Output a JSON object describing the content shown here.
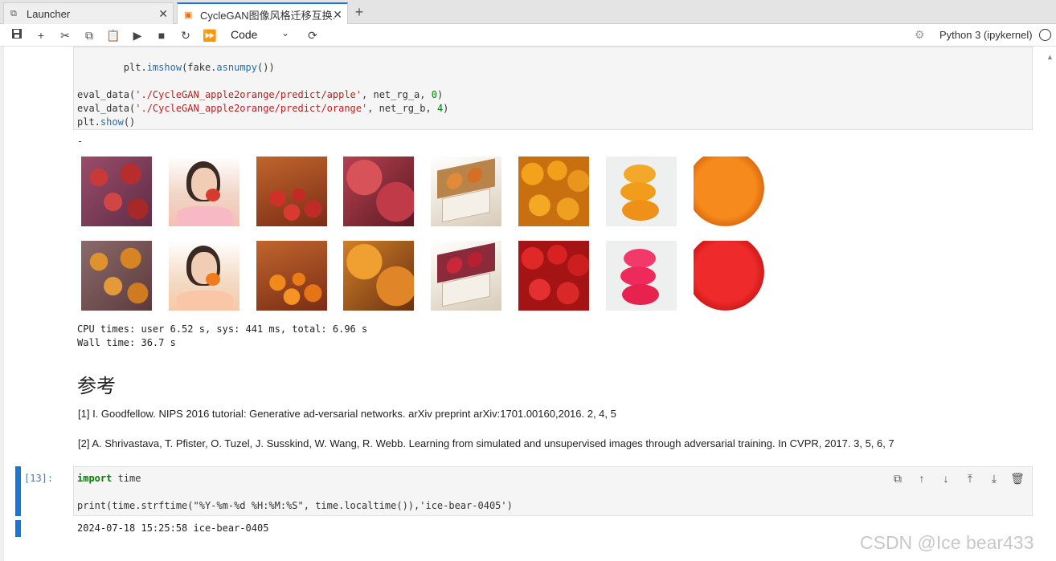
{
  "tabs": [
    {
      "label": "Launcher",
      "icon": "external-link-icon"
    },
    {
      "label": "CycleGAN图像风格迁移互换.",
      "icon": "notebook-icon"
    }
  ],
  "toolbar": {
    "cell_type": "Code",
    "kernel": "Python 3 (ipykernel)"
  },
  "code_cell_top": {
    "lines": [
      "        plt.imshow(fake.asnumpy())",
      "",
      "eval_data('./CycleGAN_apple2orange/predict/apple', net_rg_a, 0)",
      "eval_data('./CycleGAN_apple2orange/predict/orange', net_rg_b, 4)",
      "plt.show()"
    ]
  },
  "output_top": {
    "dash": "-",
    "row1_images": [
      "red-apples-pile",
      "woman-eating-apple",
      "apples-in-basket",
      "apples-closeup",
      "fruit-box",
      "oranges-pile",
      "orange-stack",
      "orange-texture"
    ],
    "row2_images": [
      "oranges-pile-converted",
      "woman-eating-orange",
      "oranges-in-basket",
      "oranges-closeup",
      "fruit-box-red",
      "red-apples-converted",
      "red-stack",
      "red-texture"
    ],
    "cpu_times": "CPU times: user 6.52 s, sys: 441 ms, total: 6.96 s",
    "wall_time": "Wall time: 36.7 s"
  },
  "markdown": {
    "heading": "参考",
    "ref1": "[1] I. Goodfellow. NIPS 2016 tutorial: Generative ad-versarial networks. arXiv preprint arXiv:1701.00160,2016. 2, 4, 5",
    "ref2": "[2] A. Shrivastava, T. Pfister, O. Tuzel, J. Susskind, W. Wang, R. Webb. Learning from simulated and unsupervised images through adversarial training. In CVPR, 2017. 3, 5, 6, 7"
  },
  "code_cell_bottom": {
    "prompt": "[13]:",
    "line1_kw": "import",
    "line1_rest": " time",
    "line2": "print(time.strftime(\"%Y-%m-%d %H:%M:%S\", time.localtime()),'ice-bear-0405')",
    "output": "2024-07-18 15:25:58 ice-bear-0405"
  },
  "watermark": "CSDN @Ice  bear433",
  "colors": {
    "accent": "#1976d2",
    "code_bg": "#f5f5f5"
  }
}
